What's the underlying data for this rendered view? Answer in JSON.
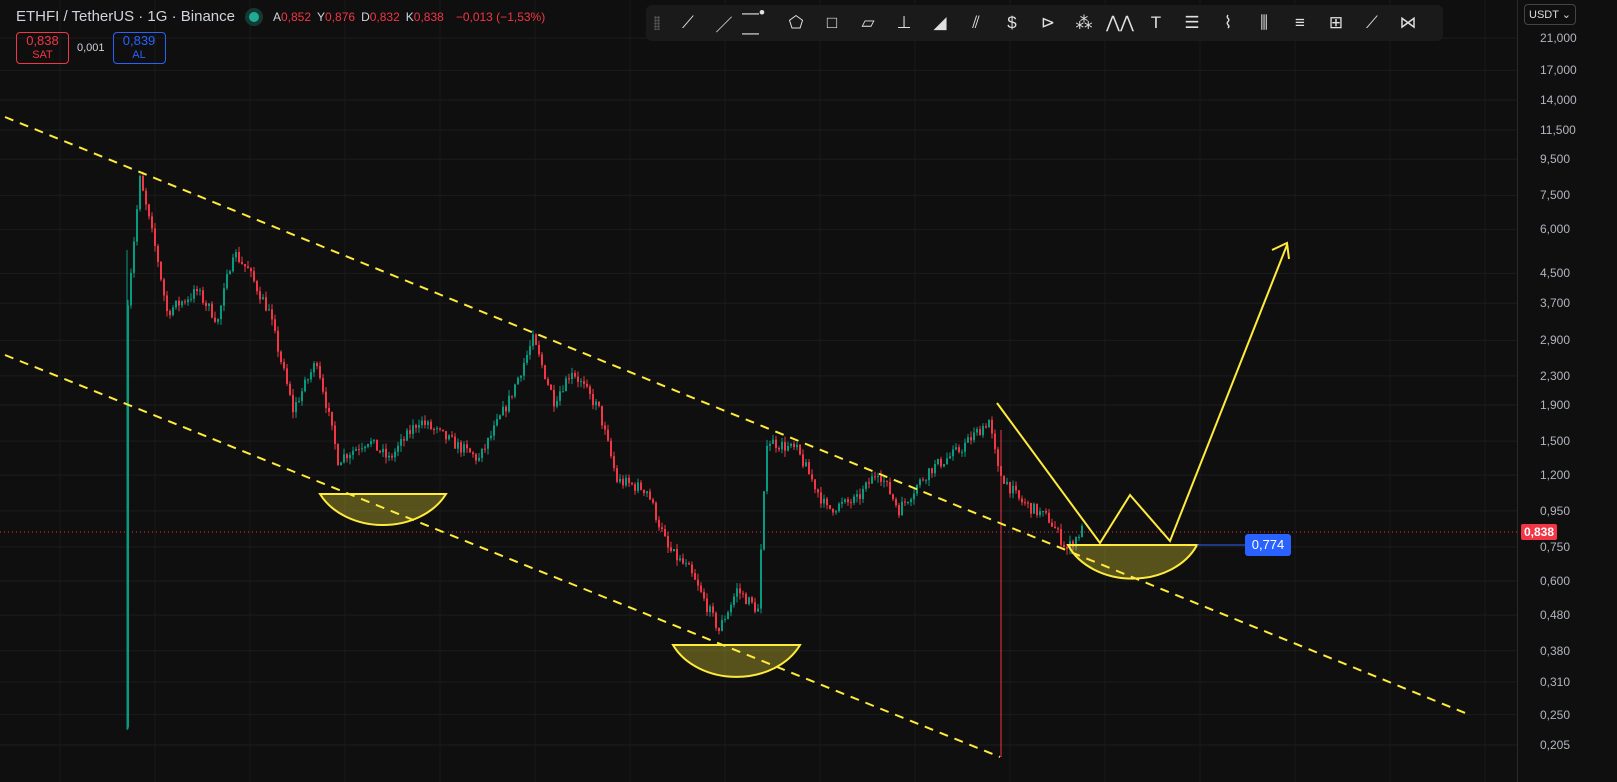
{
  "header": {
    "title": "ETHFI / TetherUS · 1G · Binance",
    "ohlc": [
      {
        "k": "A",
        "v": "0,852"
      },
      {
        "k": "Y",
        "v": "0,876"
      },
      {
        "k": "D",
        "v": "0,832"
      },
      {
        "k": "K",
        "v": "0,838"
      }
    ],
    "change": "−0,013 (−1,53%)"
  },
  "trade": {
    "sell_price": "0,838",
    "sell_label": "SAT",
    "spread": "0,001",
    "buy_price": "0,839",
    "buy_label": "AL"
  },
  "toolbar": {
    "tools": [
      "trend-line",
      "ray",
      "horizontal-ray",
      "polygon",
      "rectangle",
      "parallel-channel",
      "price-range",
      "arc",
      "pitchfork",
      "long-position",
      "fib-fan",
      "pattern",
      "elliott-wave",
      "text",
      "fib-retracement",
      "path",
      "bars-pattern",
      "gann",
      "date-price-range",
      "brush",
      "xabcd"
    ]
  },
  "axis": {
    "currency": "USDT ⌄",
    "ticks": [
      "21,000",
      "17,000",
      "14,000",
      "11,500",
      "9,500",
      "7,500",
      "6,000",
      "4,500",
      "3,700",
      "2,900",
      "2,300",
      "1,900",
      "1,500",
      "1,200",
      "0,950",
      "0,750",
      "0,600",
      "0,480",
      "0,380",
      "0,310",
      "0,250",
      "0,205"
    ],
    "current_price": "0,838"
  },
  "annotation": {
    "target_label": "0,774"
  },
  "colors": {
    "up": "#089981",
    "down": "#f23645",
    "drawing": "#ffeb3b"
  },
  "price_path": [
    [
      0,
      0.23
    ],
    [
      1,
      3.8
    ],
    [
      5,
      8.3
    ],
    [
      11,
      4.9
    ],
    [
      14,
      3.5
    ],
    [
      24,
      4.0
    ],
    [
      31,
      3.3
    ],
    [
      36,
      5.2
    ],
    [
      41,
      4.6
    ],
    [
      48,
      3.5
    ],
    [
      56,
      1.84
    ],
    [
      64,
      2.55
    ],
    [
      71,
      1.33
    ],
    [
      81,
      1.51
    ],
    [
      88,
      1.33
    ],
    [
      98,
      1.72
    ],
    [
      108,
      1.51
    ],
    [
      118,
      1.33
    ],
    [
      128,
      1.96
    ],
    [
      136,
      2.91
    ],
    [
      143,
      1.96
    ],
    [
      149,
      2.39
    ],
    [
      158,
      1.84
    ],
    [
      164,
      1.16
    ],
    [
      174,
      1.09
    ],
    [
      181,
      0.74
    ],
    [
      188,
      0.645
    ],
    [
      198,
      0.435
    ],
    [
      204,
      0.566
    ],
    [
      211,
      0.496
    ],
    [
      214,
      1.51
    ],
    [
      224,
      1.41
    ],
    [
      234,
      0.96
    ],
    [
      244,
      1.02
    ],
    [
      251,
      1.24
    ],
    [
      258,
      0.96
    ],
    [
      268,
      1.24
    ],
    [
      278,
      1.41
    ],
    [
      288,
      1.72
    ],
    [
      291,
      1.24
    ],
    [
      298,
      1.02
    ],
    [
      308,
      0.9
    ],
    [
      314,
      0.74
    ],
    [
      319,
      0.838
    ]
  ]
}
